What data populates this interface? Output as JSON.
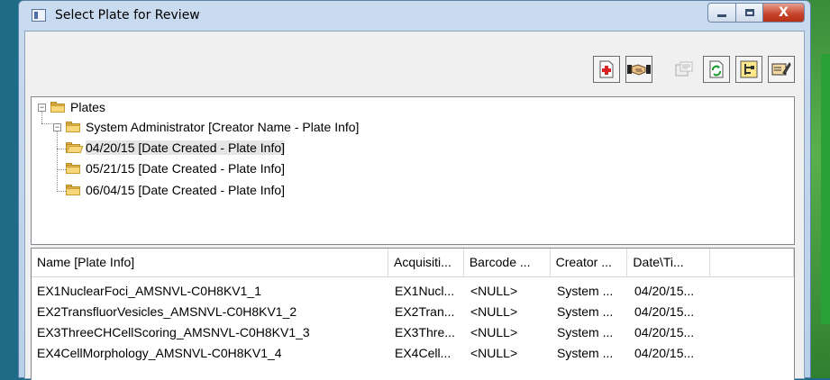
{
  "window": {
    "title": "Select Plate for Review"
  },
  "caption_buttons": {
    "close_label": "X"
  },
  "toolbar": {
    "buttons": [
      {
        "icon": "add-plate-icon",
        "enabled": true
      },
      {
        "icon": "handshake-icon",
        "enabled": true
      },
      {
        "icon": "properties-icon",
        "enabled": false
      },
      {
        "icon": "refresh-icon",
        "enabled": true
      },
      {
        "icon": "tree-view-icon",
        "enabled": true
      },
      {
        "icon": "edit-card-icon",
        "enabled": true
      }
    ]
  },
  "tree": {
    "root": {
      "label": "Plates",
      "expanded": true
    },
    "creator": {
      "label": "System Administrator [Creator Name - Plate Info]",
      "expanded": true
    },
    "dates": [
      {
        "label": "04/20/15 [Date Created - Plate Info]",
        "selected": true
      },
      {
        "label": "05/21/15 [Date Created - Plate Info]",
        "selected": false
      },
      {
        "label": "06/04/15 [Date Created - Plate Info]",
        "selected": false
      }
    ]
  },
  "list": {
    "columns": [
      "Name [Plate Info]",
      "Acquisiti...",
      "Barcode ...",
      "Creator ...",
      "Date\\Ti...",
      ""
    ],
    "rows": [
      [
        "EX1NuclearFoci_AMSNVL-C0H8KV1_1",
        "EX1Nucl...",
        "<NULL>",
        "System ...",
        "04/20/15..."
      ],
      [
        "EX2TransfluorVesicles_AMSNVL-C0H8KV1_2",
        "EX2Tran...",
        "<NULL>",
        "System ...",
        "04/20/15..."
      ],
      [
        "EX3ThreeCHCellScoring_AMSNVL-C0H8KV1_3",
        "EX3Thre...",
        "<NULL>",
        "System ...",
        "04/20/15..."
      ],
      [
        "EX4CellMorphology_AMSNVL-C0H8KV1_4",
        "EX4Cell...",
        "<NULL>",
        "System ...",
        "04/20/15..."
      ]
    ]
  }
}
